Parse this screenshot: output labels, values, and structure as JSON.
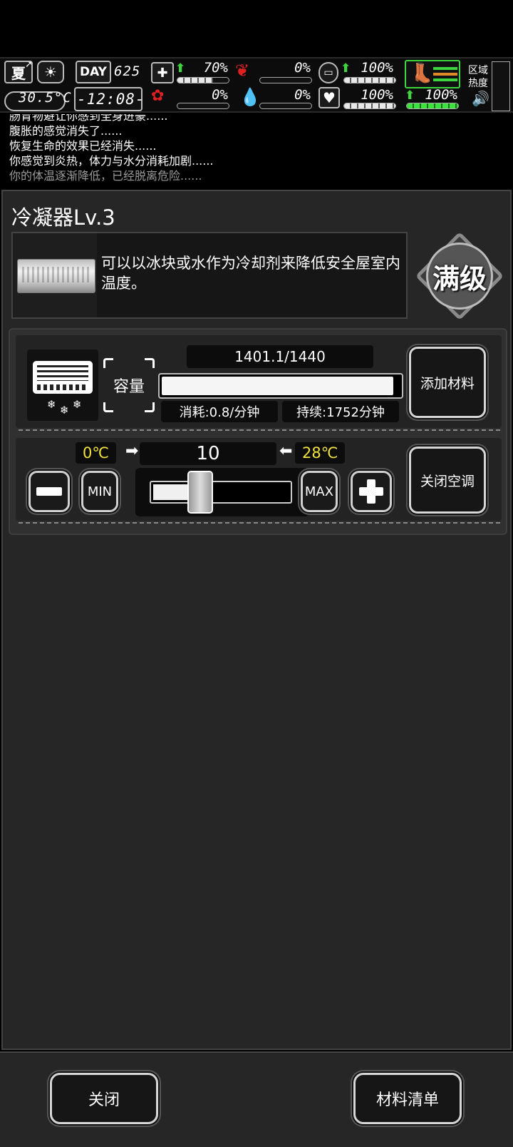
{
  "hud": {
    "season": "夏",
    "temperature": "30.5°C",
    "day_label": "DAY",
    "day_number": "625",
    "clock": "-12:08-",
    "stats": [
      {
        "icon": "medkit-icon",
        "value": "70%",
        "level": 0.7,
        "trend": "up"
      },
      {
        "icon": "stomach-icon",
        "value": "0%",
        "level": 0,
        "trend": ""
      },
      {
        "icon": "bladder-icon",
        "value": "100%",
        "level": 1,
        "trend": "up"
      },
      {
        "icon": "brain-icon",
        "value": "0%",
        "level": 0,
        "trend": ""
      },
      {
        "icon": "blood-icon",
        "value": "0%",
        "level": 0,
        "trend": ""
      },
      {
        "icon": "heart-icon",
        "value": "100%",
        "level": 1,
        "trend": ""
      }
    ],
    "stamina": {
      "value": "100%",
      "level": 1,
      "trend": "up"
    },
    "zone_label_1": "区域",
    "zone_label_2": "热度"
  },
  "log": {
    "lines": [
      "肠胃物避让你感到全身进豪......",
      "腹胀的感觉消失了......",
      "恢复生命的效果已经消失......",
      "你感觉到炎热，体力与水分消耗加剧......",
      "你的体温逐渐降低，已经脱离危险......"
    ]
  },
  "panel": {
    "title": "冷凝器Lv.3",
    "description": "可以以冰块或水作为冷却剂来降低安全屋室内温度。",
    "max_badge": "满级",
    "capacity": {
      "label": "容量",
      "value": "1401.1/1440",
      "fill": 0.973,
      "consumption": "消耗:0.8/分钟",
      "duration": "持续:1752分钟",
      "add_button": "添加材料"
    },
    "temperature": {
      "min_temp": "0℃",
      "max_temp": "28℃",
      "setting": "10",
      "level": 0.357,
      "min_button": "MIN",
      "max_button": "MAX",
      "toggle_button": "关闭空调"
    }
  },
  "footer": {
    "close_button": "关闭",
    "materials_button": "材料清单"
  },
  "colors": {
    "temp_badge": "#f2e23a",
    "up_arrow": "#3ed63e",
    "danger": "#e02020"
  }
}
